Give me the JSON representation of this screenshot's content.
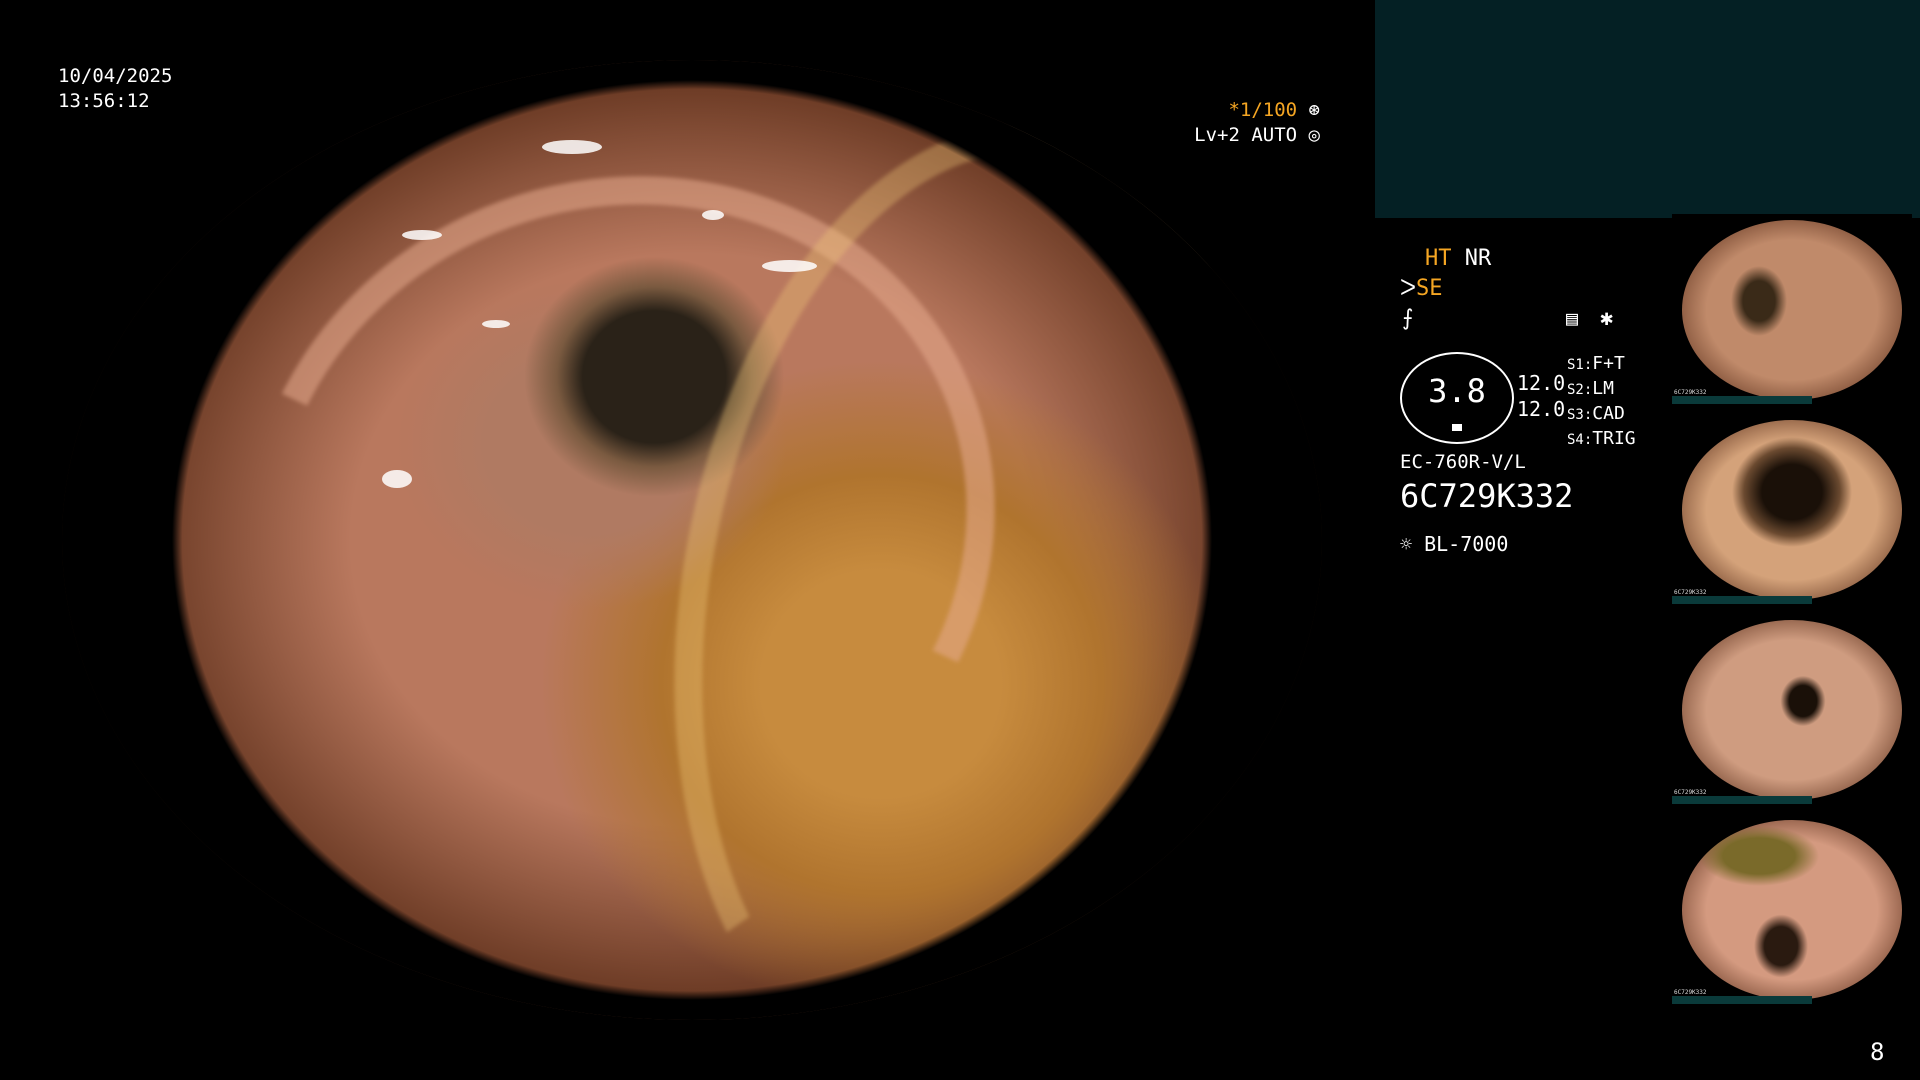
{
  "overlay": {
    "date": "10/04/2025",
    "time": "13:56:12",
    "shutter": "*1/100",
    "level": "Lv+2 AUTO",
    "page_number": "8"
  },
  "settings": {
    "ht": "HT",
    "nr": "NR",
    "se": "SE",
    "zoom_value": "3.8",
    "value_a": "12.0",
    "value_b": "12.0",
    "s1_key": "S1:",
    "s1_val": "F+T",
    "s2_key": "S2:",
    "s2_val": "LM",
    "s3_key": "S3:",
    "s3_val": "CAD",
    "s4_key": "S4:",
    "s4_val": "TRIG",
    "scope_model": "EC-760R-V/L",
    "serial": "6C729K332",
    "light_source": "BL-7000"
  },
  "thumbnails": [
    {
      "label": "6C729K332"
    },
    {
      "label": "6C729K332"
    },
    {
      "label": "6C729K332"
    },
    {
      "label": "6C729K332"
    }
  ],
  "colors": {
    "panel": "#042024",
    "accent": "#f5a623"
  }
}
